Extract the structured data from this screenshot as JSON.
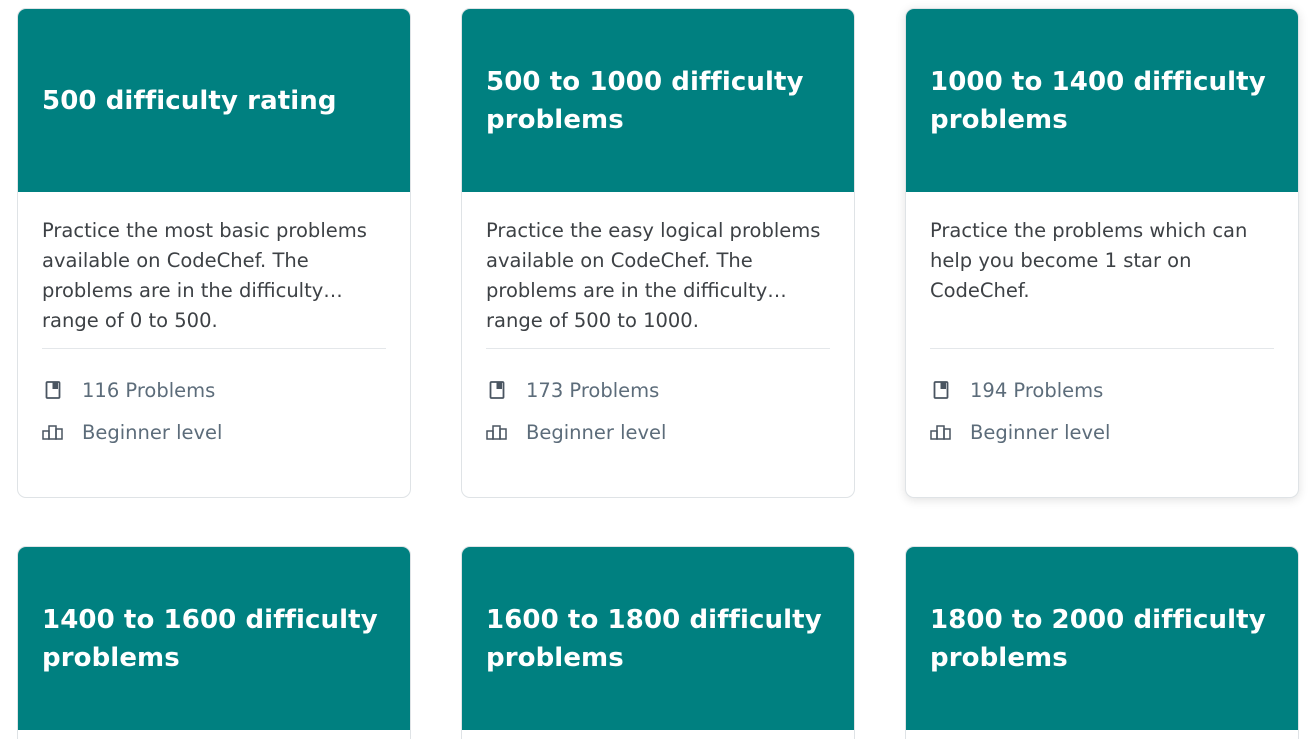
{
  "cards": [
    {
      "title": "500 difficulty rating",
      "description": "Practice the most basic problems available on CodeChef. The problems are in the difficulty range of 0 to 500.",
      "problems": "116 Problems",
      "level": "Beginner level"
    },
    {
      "title": "500 to 1000 difficulty problems",
      "description": "Practice the easy logical problems available on CodeChef. The problems are in the difficulty range of 500 to 1000.",
      "problems": "173 Problems",
      "level": "Beginner level"
    },
    {
      "title": "1000 to 1400 difficulty problems",
      "description": "Practice the problems which can help you become 1 star on CodeChef.",
      "problems": "194 Problems",
      "level": "Beginner level"
    },
    {
      "title": "1400 to 1600 difficulty problems"
    },
    {
      "title": "1600 to 1800 difficulty problems"
    },
    {
      "title": "1800 to 2000 difficulty problems"
    }
  ],
  "colors": {
    "header": "#008080",
    "title_text": "#ffffff",
    "description_text": "#3d4145",
    "meta_text": "#5c6c7a"
  },
  "icons": {
    "problems": "document-icon",
    "level": "level-bars-icon"
  }
}
